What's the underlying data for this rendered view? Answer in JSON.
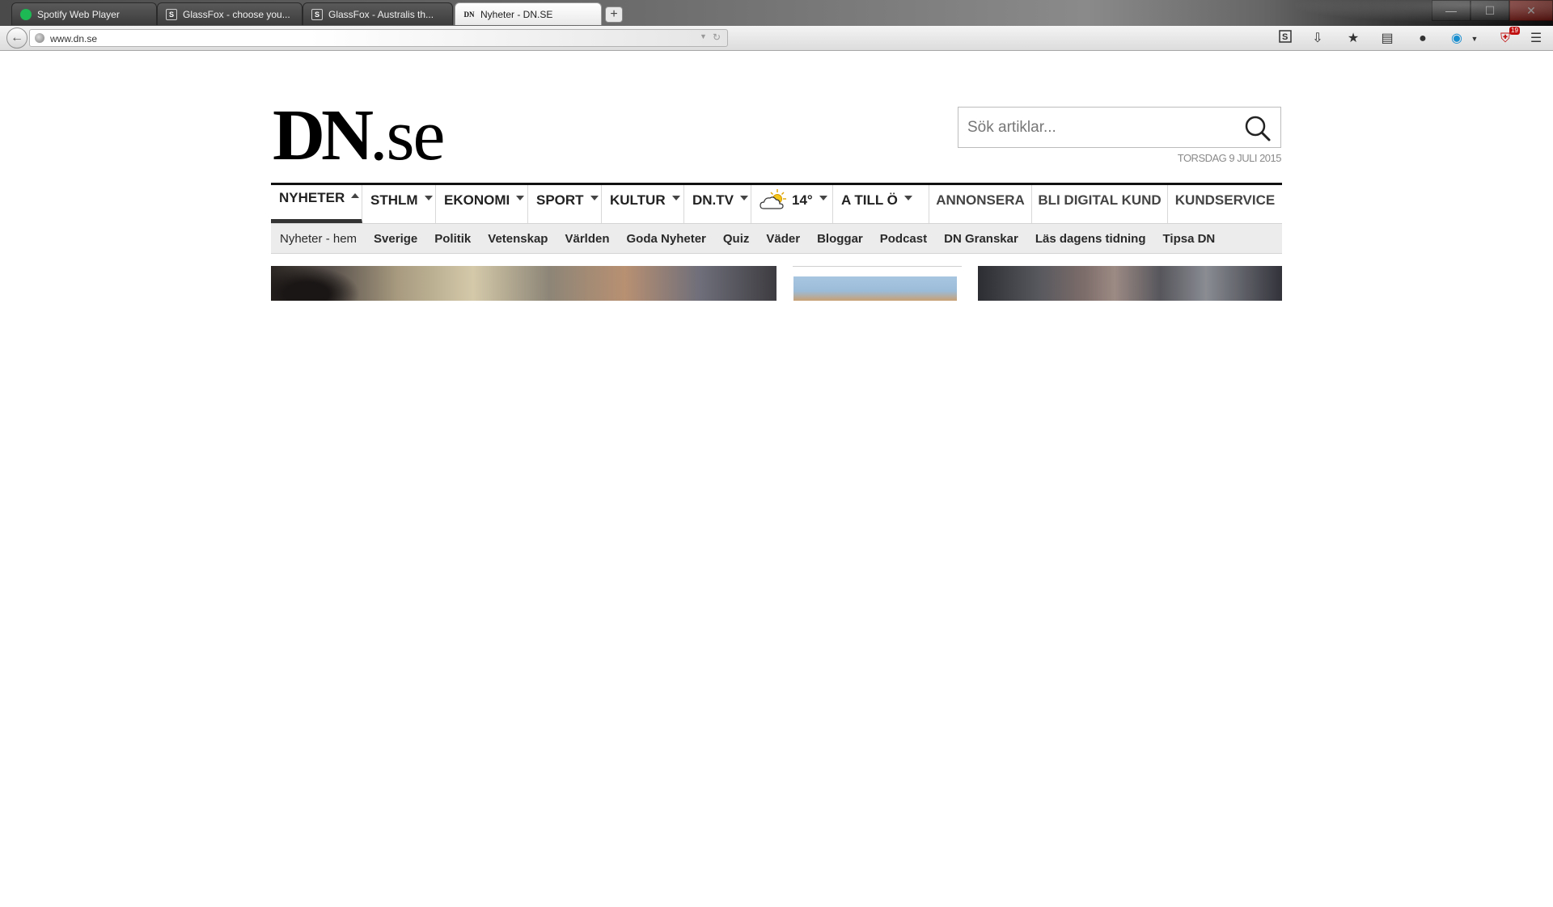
{
  "browser": {
    "tabs": [
      {
        "title": "Spotify Web Player",
        "icon": "spotify-icon"
      },
      {
        "title": "GlassFox - choose you...",
        "icon": "glassfox-icon"
      },
      {
        "title": "GlassFox - Australis th...",
        "icon": "glassfox-icon"
      },
      {
        "title": "Nyheter - DN.SE",
        "icon": "dn-icon",
        "active": true
      }
    ],
    "new_tab": "+",
    "url": "www.dn.se",
    "window_controls": {
      "minimize": "—",
      "maximize": "☐",
      "close": "✕"
    },
    "toolbar_badge": "19"
  },
  "site": {
    "logo_main": "DN",
    "logo_suffix": ".se",
    "search_placeholder": "Sök artiklar...",
    "date": "TORSDAG 9 JULI 2015",
    "main_nav": [
      {
        "label": "NYHETER",
        "caret": "up",
        "active": true
      },
      {
        "label": "STHLM",
        "caret": "down"
      },
      {
        "label": "EKONOMI",
        "caret": "down"
      },
      {
        "label": "SPORT",
        "caret": "down"
      },
      {
        "label": "KULTUR",
        "caret": "down"
      },
      {
        "label": "DN.TV",
        "caret": "down"
      },
      {
        "label": "14°",
        "caret": "down",
        "icon": "weather-partly-cloudy-icon"
      },
      {
        "label": "A TILL Ö",
        "caret": "down"
      },
      {
        "label": "ANNONSERA"
      },
      {
        "label": "BLI DIGITAL KUND"
      },
      {
        "label": "KUNDSERVICE"
      }
    ],
    "sub_nav": [
      "Nyheter - hem",
      "Sverige",
      "Politik",
      "Vetenskap",
      "Världen",
      "Goda Nyheter",
      "Quiz",
      "Väder",
      "Bloggar",
      "Podcast",
      "DN Granskar",
      "Läs dagens tidning",
      "Tipsa DN"
    ]
  },
  "colors": {
    "accent": "#111111",
    "subnav_bg": "#ececec",
    "close_button": "#c0392b"
  }
}
